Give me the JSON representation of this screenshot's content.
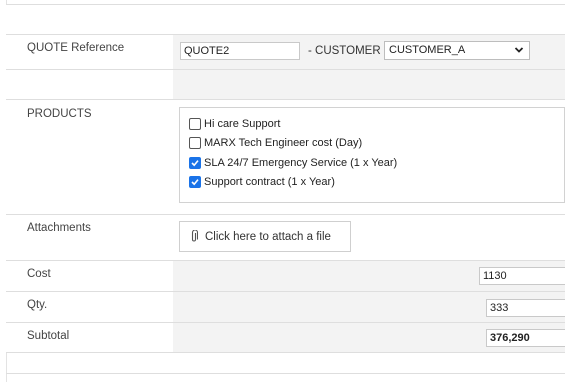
{
  "form": {
    "quote_reference": {
      "label": "QUOTE Reference",
      "value": "QUOTE2",
      "separator": "- CUSTOMER",
      "customer_selected": "CUSTOMER_A"
    },
    "products": {
      "label": "PRODUCTS",
      "items": [
        {
          "label": "Hi care Support",
          "checked": false
        },
        {
          "label": "MARX Tech Engineer cost (Day)",
          "checked": false
        },
        {
          "label": "SLA 24/7 Emergency Service (1 x Year)",
          "checked": true
        },
        {
          "label": "Support contract (1 x Year)",
          "checked": true
        }
      ]
    },
    "attachments": {
      "label": "Attachments",
      "button_label": "Click here to attach a file",
      "icon": "paperclip-icon"
    },
    "cost": {
      "label": "Cost",
      "value": "1130"
    },
    "qty": {
      "label": "Qty.",
      "value": "333"
    },
    "subtotal": {
      "label": "Subtotal",
      "value": "376,290"
    }
  },
  "colors": {
    "label_bg": "#ffffff",
    "value_bg": "#f3f3f3",
    "checkbox_checked": "#1a73e8",
    "border": "#dedede"
  }
}
